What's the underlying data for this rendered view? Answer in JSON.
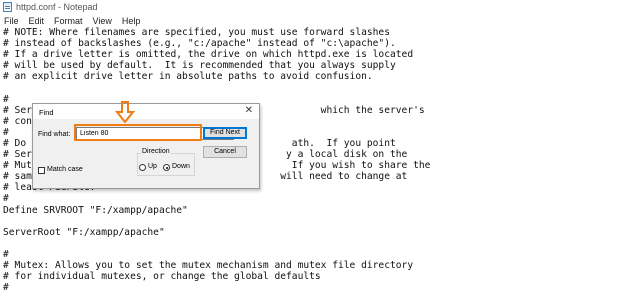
{
  "window": {
    "title": "httpd.conf - Notepad",
    "app_icon": "notepad-icon"
  },
  "menu": [
    "File",
    "Edit",
    "Format",
    "View",
    "Help"
  ],
  "editor": {
    "lines": [
      "# NOTE: Where filenames are specified, you must use forward slashes",
      "# instead of backslashes (e.g., \"c:/apache\" instead of \"c:\\apache\").",
      "# If a drive letter is omitted, the drive on which httpd.exe is located",
      "# will be used by default.  It is recommended that you always supply",
      "# an explicit drive letter in absolute paths to avoid confusion.",
      "",
      "#",
      "# Serv                                                 which the server's",
      "# conf",
      "#",
      "# Do n                                            ath.  If you point",
      "# Serv                                           y a local disk on the",
      "# Mute                                            If you wish to share the",
      "# same                                          will need to change at",
      "# least PidFile.",
      "#",
      "Define SRVROOT \"F:/xampp/apache\"",
      "",
      "ServerRoot \"F:/xampp/apache\"",
      "",
      "#",
      "# Mutex: Allows you to set the mutex mechanism and mutex file directory",
      "# for individual mutexes, or change the global defaults",
      "#"
    ]
  },
  "find_dialog": {
    "title": "Find",
    "find_what_label": "Find what:",
    "find_what_value": "Listen 80",
    "find_next_label": "Find Next",
    "cancel_label": "Cancel",
    "direction_label": "Direction",
    "up_label": "Up",
    "down_label": "Down",
    "direction_selected": "Down",
    "match_case_label": "Match case",
    "match_case_checked": false
  },
  "annotation": {
    "color": "#f07c13"
  }
}
